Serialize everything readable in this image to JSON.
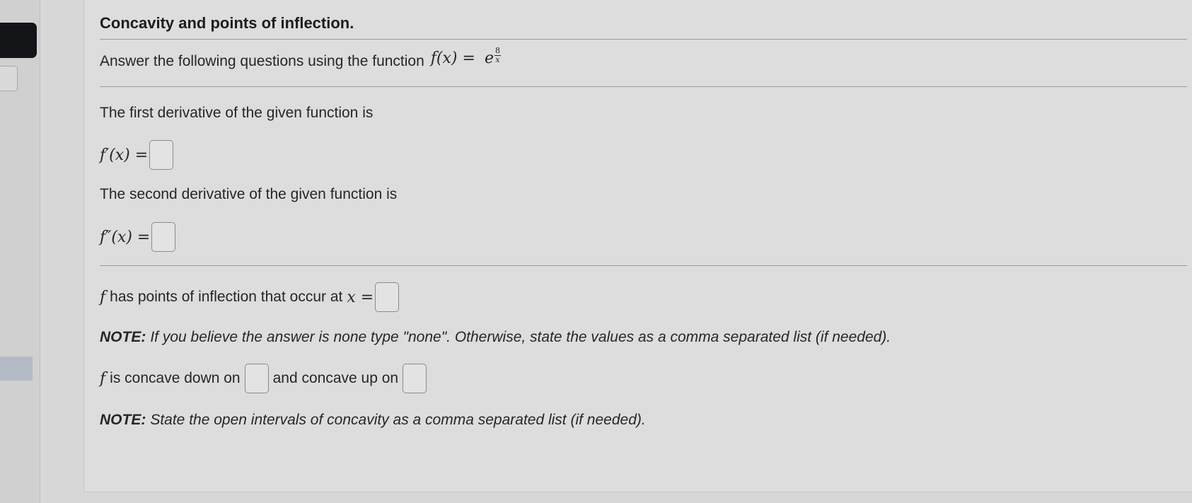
{
  "title": "Concavity and points of inflection.",
  "intro": {
    "text": "Answer the following questions using the function",
    "function_lhs": "f(x) =",
    "function_base": "e",
    "exp_numerator": "8",
    "exp_denominator": "x"
  },
  "first_derivative": {
    "label": "The first derivative of the given function is",
    "lhs": "f′(x) ="
  },
  "second_derivative": {
    "label": "The second derivative of the given function is",
    "lhs": "f″(x) ="
  },
  "inflection": {
    "f_symbol": "f",
    "text": "has points of inflection that occur at",
    "var": "x =",
    "note_label": "NOTE:",
    "note_text": "If you believe the answer is none type \"none\". Otherwise, state the values as a comma separated list (if needed)."
  },
  "concavity": {
    "f_symbol": "f",
    "down_text": "is concave down on",
    "up_text": "and concave up on",
    "note_label": "NOTE:",
    "note_text": "State the open intervals of concavity as a comma separated list (if needed)."
  },
  "answers": {
    "first_derivative": "",
    "second_derivative": "",
    "inflection_points": "",
    "concave_down": "",
    "concave_up": ""
  },
  "colors": {
    "background": "#d6d7d6",
    "panel": "#dcdddc",
    "text": "#262626",
    "sidebar_dark_tab": "#121417",
    "sidebar_highlight": "#b3bbc4"
  }
}
